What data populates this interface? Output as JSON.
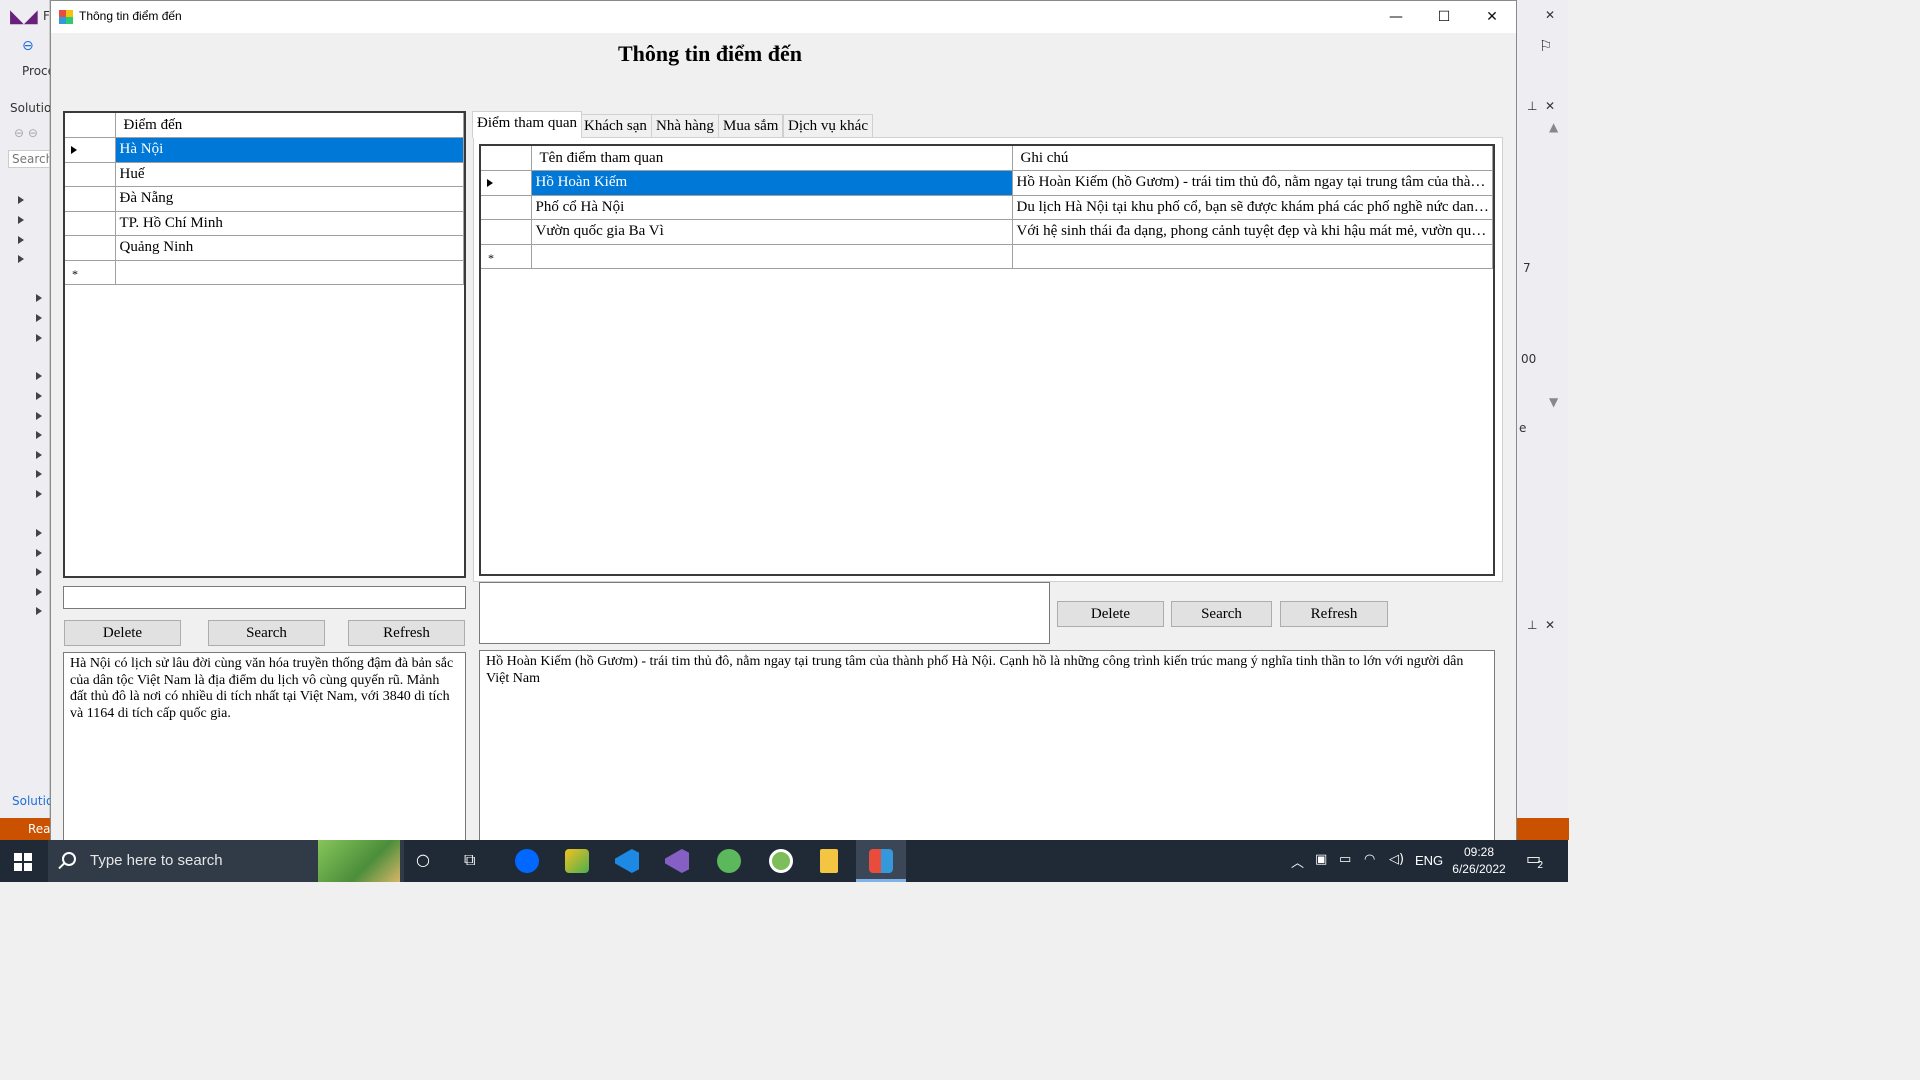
{
  "window": {
    "title": "Thông tin điểm đến",
    "form_title": "Thông tin điểm đến"
  },
  "left_grid": {
    "header": "Điểm đến",
    "rows": [
      "Hà Nội",
      "Huế",
      "Đà Nẵng",
      "TP. Hồ Chí Minh",
      "Quảng Ninh"
    ],
    "selected_index": 0
  },
  "left_search": {
    "value": ""
  },
  "left_buttons": {
    "delete": "Delete",
    "search": "Search",
    "refresh": "Refresh"
  },
  "left_description": "Hà Nội có lịch sử lâu đời cùng văn hóa truyền thống đậm đà bản sắc của dân tộc Việt Nam là địa điểm du lịch vô cùng quyến rũ. Mảnh đất thủ đô là nơi có nhiều di tích nhất tại Việt Nam, với 3840 di tích và 1164 di tích cấp quốc gia.",
  "tabs": [
    "Điểm tham quan",
    "Khách sạn",
    "Nhà hàng",
    "Mua sắm",
    "Dịch vụ khác"
  ],
  "active_tab": 0,
  "right_grid": {
    "headers": [
      "Tên điểm tham quan",
      "Ghi chú"
    ],
    "rows": [
      {
        "name": "Hồ Hoàn Kiếm",
        "note": "Hồ Hoàn Kiếm (hồ Gươm) - trái tim thủ đô, nằm ngay tại trung tâm của thành ..."
      },
      {
        "name": "Phố cổ Hà Nội",
        "note": "Du lịch Hà Nội tại khu phố cổ, bạn sẽ được khám phá các phố nghề nức danh, ..."
      },
      {
        "name": "Vườn quốc gia Ba Vì",
        "note": "Với hệ sinh thái đa dạng, phong cảnh tuyệt đẹp và khi hậu mát mẻ, vườn quốc ..."
      }
    ],
    "selected_index": 0
  },
  "right_search": {
    "value": ""
  },
  "right_buttons": {
    "delete": "Delete",
    "search": "Search",
    "refresh": "Refresh"
  },
  "right_description": "Hồ Hoàn Kiếm (hồ Gươm) - trái tim thủ đô, nằm ngay tại trung tâm của thành phố Hà Nội. Cạnh hồ là những công trình kiến trúc mang ý nghĩa tinh thần to lớn với người dân Việt Nam",
  "vs_background": {
    "left_texts": [
      "F",
      "Proce",
      "Solutio",
      "Search",
      "Solutio",
      "Rea"
    ],
    "right_texts": [
      "7",
      "00",
      "e"
    ]
  },
  "taskbar": {
    "search_placeholder": "Type here to search",
    "language": "ENG",
    "time": "09:28",
    "date": "6/26/2022",
    "notification_count": "2",
    "apps": [
      "task-view",
      "zalo",
      "sublime",
      "vscode",
      "visual-studio",
      "app-green",
      "app-panda",
      "file-explorer",
      "winforms-app"
    ]
  }
}
